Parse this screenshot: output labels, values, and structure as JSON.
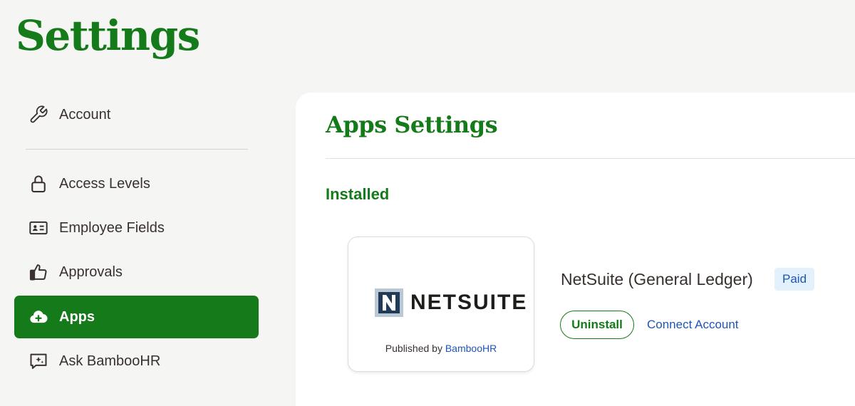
{
  "page": {
    "title": "Settings"
  },
  "nav": {
    "items": [
      {
        "label": "Account",
        "icon": "wrench-icon"
      },
      {
        "label": "Access Levels",
        "icon": "lock-icon"
      },
      {
        "label": "Employee Fields",
        "icon": "id-card-icon"
      },
      {
        "label": "Approvals",
        "icon": "thumbs-up-icon"
      },
      {
        "label": "Apps",
        "icon": "cloud-plus-icon",
        "active": true
      },
      {
        "label": "Ask BambooHR",
        "icon": "sparkle-chat-icon"
      }
    ]
  },
  "panel": {
    "title": "Apps Settings",
    "section": "Installed",
    "app": {
      "logo_text": "NETSUITE",
      "published_prefix": "Published by",
      "publisher": "BambooHR",
      "name": "NetSuite (General Ledger)",
      "badge": "Paid",
      "uninstall_label": "Uninstall",
      "connect_label": "Connect Account"
    }
  },
  "colors": {
    "brand": "#157a1a",
    "link": "#1f55b5",
    "badge_bg": "#e2f1fb",
    "text": "#38312f"
  }
}
